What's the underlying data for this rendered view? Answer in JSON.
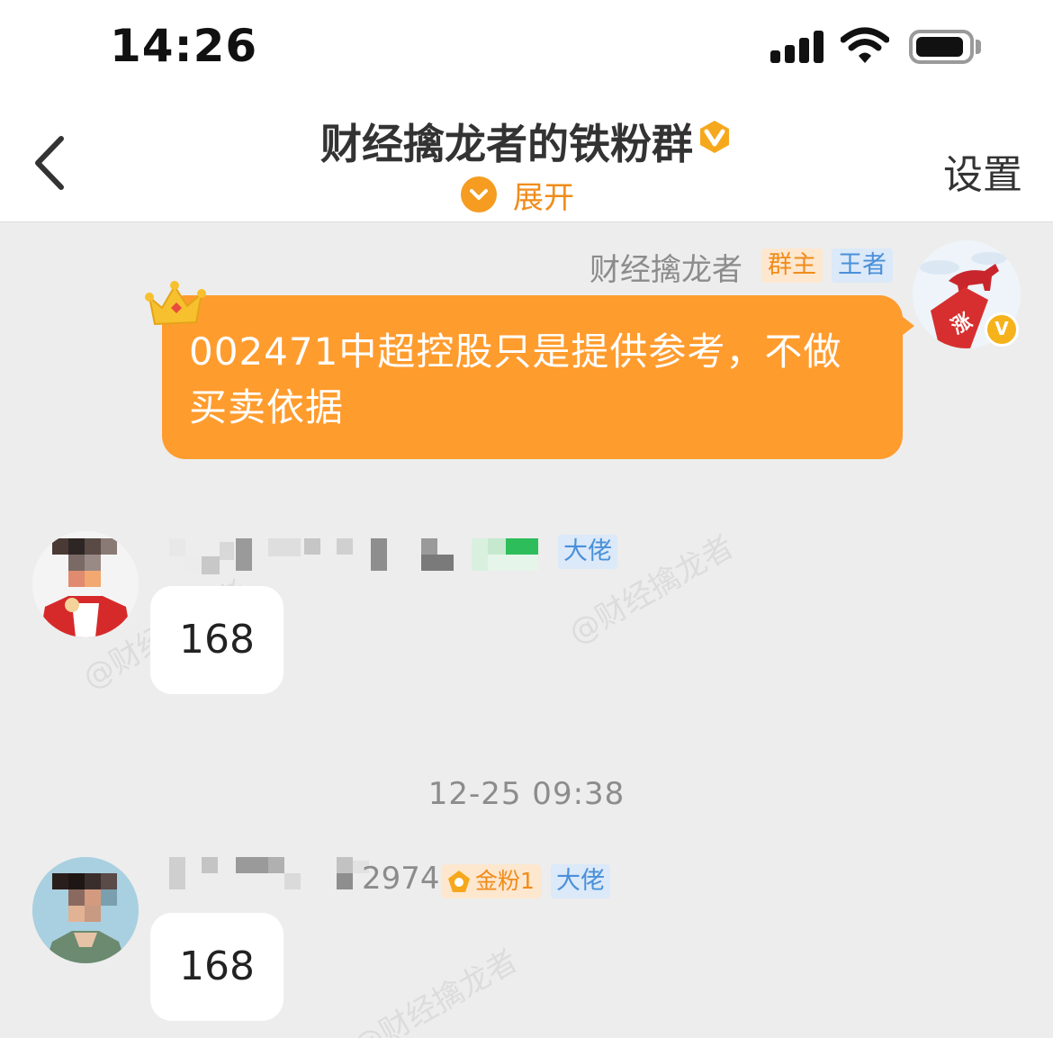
{
  "status_bar": {
    "time": "14:26"
  },
  "nav": {
    "title": "财经擒龙者的铁粉群",
    "expand_label": "展开",
    "settings_label": "设置",
    "accent_color": "#f59c21"
  },
  "watermark_text": "@财经擒龙者",
  "messages": [
    {
      "sender": "财经擒龙者",
      "badges": [
        "群主",
        "王者"
      ],
      "avatar_label": "涨",
      "text": "002471中超控股只是提供参考，不做买卖依据",
      "bubble_color": "#ff9c2e"
    },
    {
      "sender_badge": "大佬",
      "text": "168"
    },
    {
      "timestamp": "12-25 09:38"
    },
    {
      "sender_suffix": "2974",
      "gold_badge": "金粉1",
      "sender_badge": "大佬",
      "text": "168"
    }
  ]
}
